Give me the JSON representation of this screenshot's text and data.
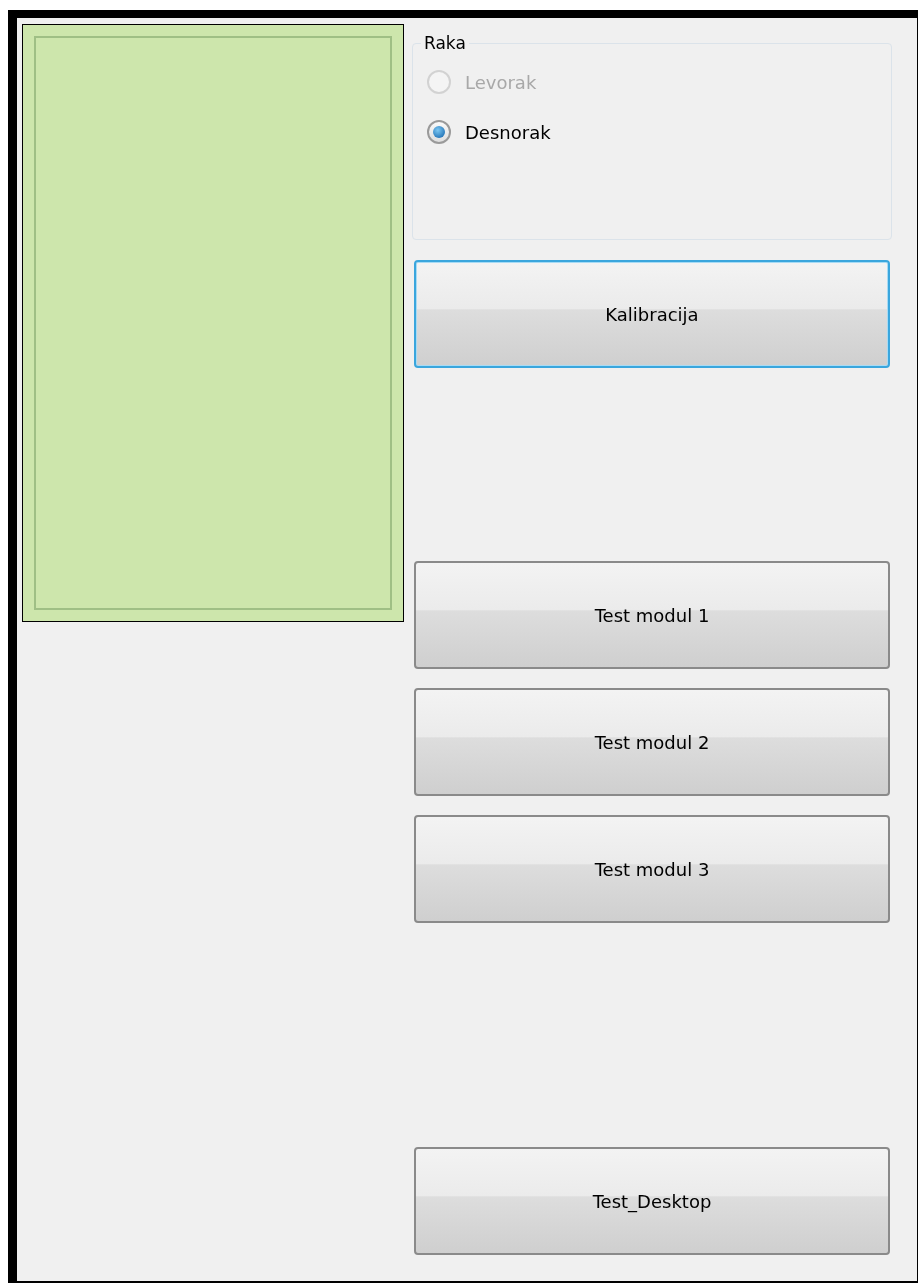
{
  "hand_group": {
    "title": "Raka",
    "options": [
      {
        "label": "Levorak",
        "selected": false,
        "disabled": true
      },
      {
        "label": "Desnorak",
        "selected": true,
        "disabled": false
      }
    ]
  },
  "calibrate_button": {
    "label": "Kalibracija",
    "focused": true
  },
  "test_modules": [
    {
      "label": "Test modul 1",
      "focused": false
    },
    {
      "label": "Test modul 2",
      "focused": false
    },
    {
      "label": "Test modul 3",
      "focused": false
    }
  ],
  "desktop_button": {
    "label": "Test_Desktop",
    "focused": false
  }
}
